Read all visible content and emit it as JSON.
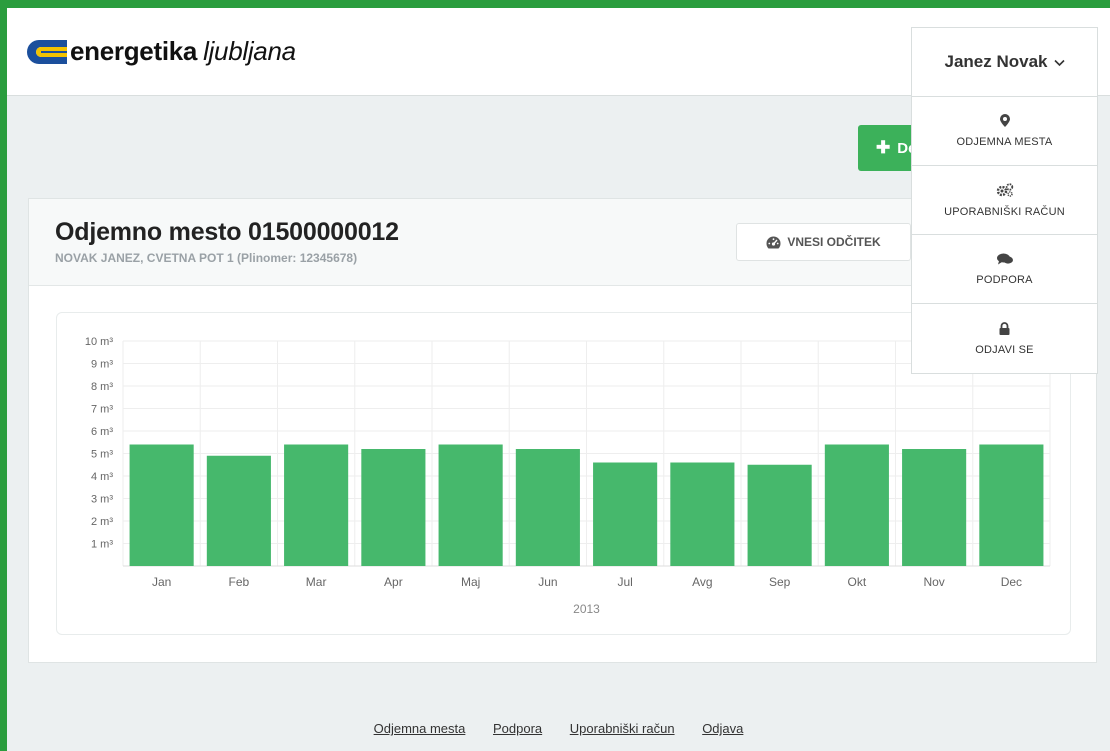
{
  "brand": {
    "bold": "energetika",
    "light": "ljubljana"
  },
  "user": {
    "name": "Janez Novak"
  },
  "menu": [
    {
      "icon": "map-marker-icon",
      "label": "ODJEMNA MESTA"
    },
    {
      "icon": "gears-icon",
      "label": "UPORABNIŠKI RAČUN"
    },
    {
      "icon": "comments-icon",
      "label": "PODPORA"
    },
    {
      "icon": "lock-icon",
      "label": "ODJAVI SE"
    }
  ],
  "add_button": {
    "label": "De"
  },
  "panel": {
    "title": "Odjemno mesto 01500000012",
    "subtitle": "NOVAK JANEZ, CVETNA POT 1 (Plinomer: 12345678)",
    "reading_button": "VNESI ODČITEK"
  },
  "chart_data": {
    "type": "bar",
    "categories": [
      "Jan",
      "Feb",
      "Mar",
      "Apr",
      "Maj",
      "Jun",
      "Jul",
      "Avg",
      "Sep",
      "Okt",
      "Nov",
      "Dec"
    ],
    "values": [
      5.4,
      4.9,
      5.4,
      5.2,
      5.4,
      5.2,
      4.6,
      4.6,
      4.5,
      5.4,
      5.2,
      5.4
    ],
    "y_ticks": [
      "1 m³",
      "2 m³",
      "3 m³",
      "4 m³",
      "5 m³",
      "6 m³",
      "7 m³",
      "8 m³",
      "9 m³",
      "10 m³"
    ],
    "ylim": [
      0,
      10
    ],
    "xlabel": "2013",
    "ylabel": "",
    "grid": true,
    "bar_color": "#46b86c"
  },
  "footer": {
    "links": [
      "Odjemna mesta",
      "Podpora",
      "Uporabniški račun",
      "Odjava"
    ]
  },
  "colors": {
    "accent": "#3cb15a",
    "frame": "#2a9d3e",
    "background": "#ecf0f1"
  }
}
